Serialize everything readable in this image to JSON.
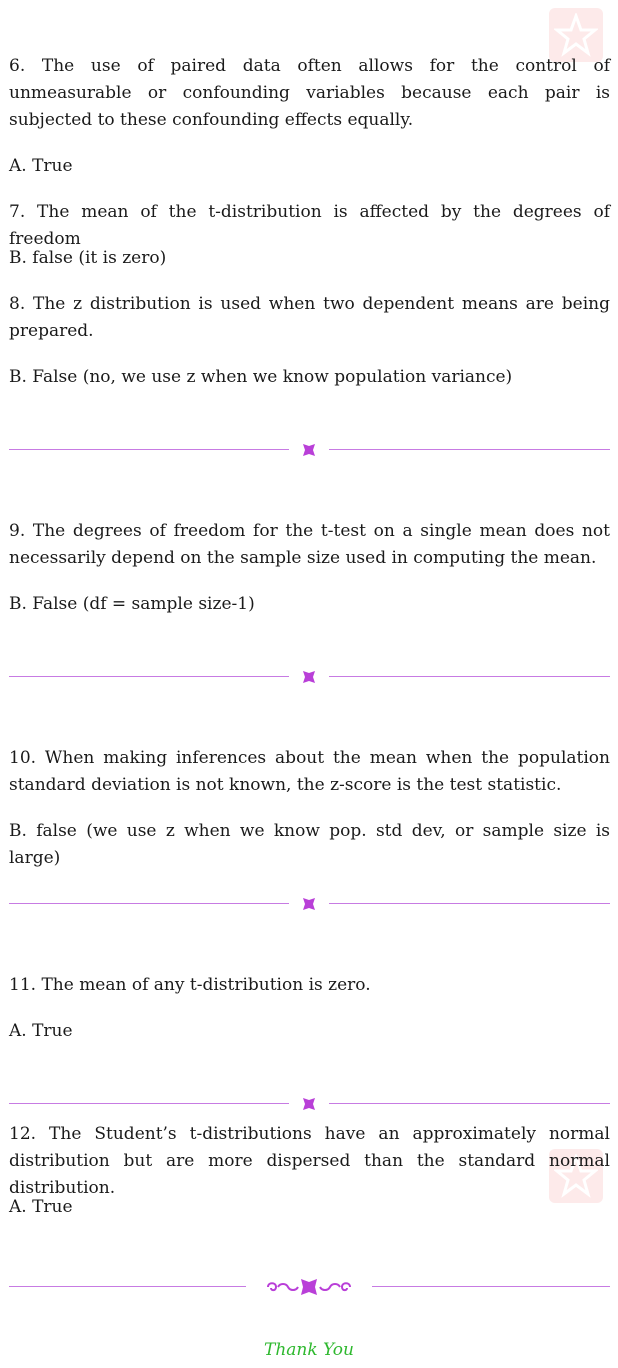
{
  "items": [
    {
      "q": "6.  The use of paired data often allows for the control of unmeasurable or confounding variables because each pair is subjected to these confounding effects equally.",
      "a": "A. True"
    },
    {
      "q": "7.  The mean of the t-distribution is affected by the degrees of freedom",
      "a": "B. false (it is zero)"
    },
    {
      "q": "8.  The z distribution is used when two dependent means are being prepared.",
      "a": "B. False (no, we use z when we know population variance)"
    },
    {
      "q": "9.  The degrees of freedom for the t-test on a single mean does not necessarily depend on the sample size used in computing the mean.",
      "a": "B. False (df = sample size-1)"
    },
    {
      "q": "10.  When making inferences about the mean when the population standard deviation is not known, the z-score is the test statistic.",
      "a": "B. false (we use z when we know pop. std dev, or sample size is large)"
    },
    {
      "q": "11.  The mean of any t-distribution is zero.",
      "a": "A. True"
    },
    {
      "q": "12.  The Student’s t-distributions have an approximately normal distribution but are more dispersed than the standard normal distribution.",
      "a": "A. True"
    }
  ],
  "footer": {
    "thanks": "Thank You"
  },
  "colors": {
    "divider": "#c77be3",
    "ornament": "#b93fd8",
    "thanks": "#2eb82e",
    "watermark": "#fdeaea"
  }
}
